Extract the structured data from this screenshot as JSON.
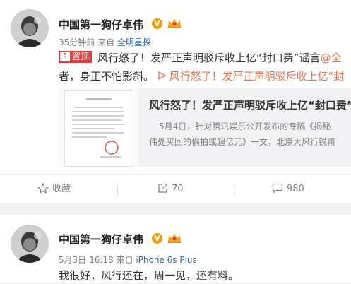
{
  "posts": [
    {
      "author": "中国第一狗仔卓伟",
      "verified_badge": "V",
      "member_icon": "vip-crown-icon",
      "time": "35分钟前",
      "source_prefix": "来自",
      "source": "全明星探",
      "pinned_label": "置顶",
      "text_line1": "风行怒了！发严正声明驳斥收上亿“封口费”谣言",
      "mention": "@全",
      "text_line2_start": "者，身正不怕影斜。",
      "link_text": "风行怒了！发严正声明驳斥收上亿“封",
      "article": {
        "title": "风行怒了！发严正声明驳斥收上亿“封口费”",
        "summary_line1": "5月4日，针对腾讯娱乐公开发布的专稿《揭秘",
        "summary_line2": "伟处买回的偷拍或超亿元》一文，北京大风行锐甫"
      },
      "actions": {
        "favorite": "收藏",
        "repost": "70",
        "comment": "980"
      }
    },
    {
      "author": "中国第一狗仔卓伟",
      "verified_badge": "V",
      "member_icon": "vip-crown-icon",
      "time": "5月3日 16:18",
      "source_prefix": "来自",
      "source": "iPhone 6s Plus",
      "text_line1": "我很好，风行还在，周一见，还有料。"
    }
  ],
  "colors": {
    "accent_orange": "#eb7350",
    "pin_red": "#e63b3b",
    "verified_gold": "#f59b05",
    "meta_gray": "#808080"
  }
}
